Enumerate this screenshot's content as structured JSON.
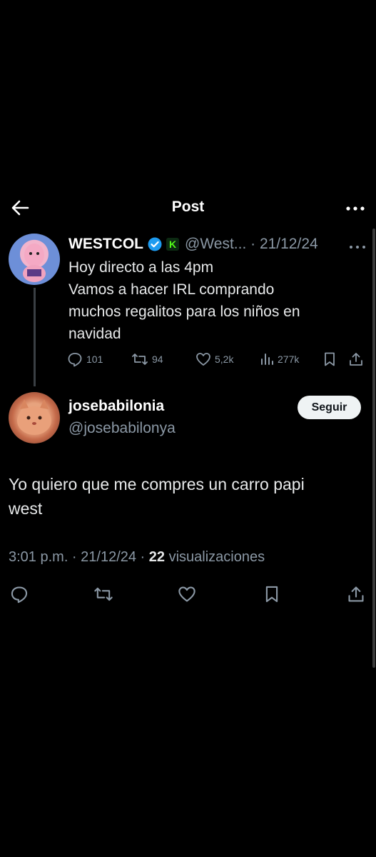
{
  "header": {
    "title": "Post",
    "back_icon": "arrow-left-icon",
    "more_icon": "ellipsis-icon"
  },
  "parent_tweet": {
    "display_name": "WESTCOL",
    "kick_badge": "K",
    "handle_date": "@West... · 21/12/24",
    "lines": [
      "Hoy directo a las 4pm",
      "Vamos a hacer IRL comprando",
      "muchos regalitos para los niños en",
      "navidad"
    ],
    "stats": {
      "replies": "101",
      "reposts": "94",
      "likes": "5,2k",
      "views": "277k"
    }
  },
  "reply": {
    "display_name": "josebabilonia",
    "handle": "@josebabilonya",
    "follow_label": "Seguir",
    "lines": [
      "Yo quiero que me compres un carro papi",
      "west"
    ],
    "time_date": "3:01 p.m. · 21/12/24 · ",
    "views_count": "22",
    "views_label": " visualizaciones"
  },
  "colors": {
    "background": "#000000",
    "text": "#e7e9ea",
    "muted": "#8b98a5",
    "verified": "#1d9bf0",
    "kick": "#53fc18"
  }
}
